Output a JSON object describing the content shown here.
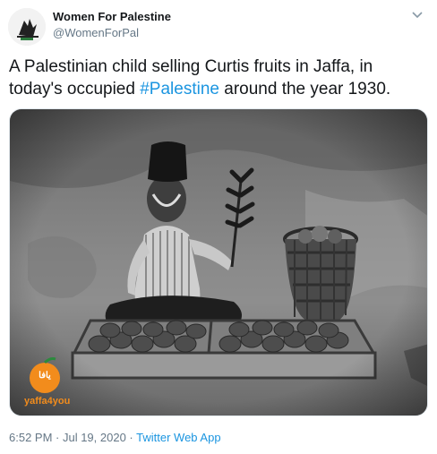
{
  "author": {
    "display_name": "Women For Palestine",
    "handle": "@WomenForPal",
    "avatar_icon": "bird-logo-icon"
  },
  "tweet": {
    "text_before": "A Palestinian child selling Curtis fruits in Jaffa, in today's occupied ",
    "hashtag": "#Palestine",
    "text_after": " around the year 1930."
  },
  "photo": {
    "watermark_badge": "يافا",
    "watermark_site": "yaffa4you"
  },
  "meta": {
    "timestamp": "6:52 PM · Jul 19, 2020",
    "separator": " · ",
    "source": "Twitter Web App"
  },
  "colors": {
    "link": "#1b95e0",
    "secondary_text": "#657786",
    "primary_text": "#14171a",
    "watermark_orange": "#f28c1c"
  }
}
